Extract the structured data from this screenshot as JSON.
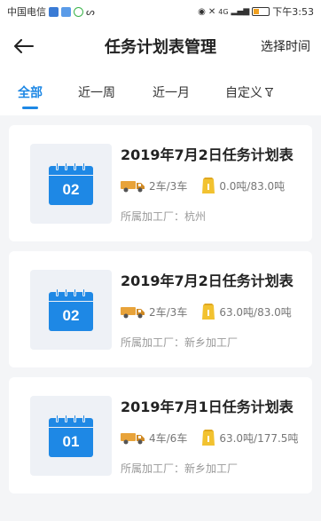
{
  "status_bar": {
    "carrier": "中国电信",
    "time": "下午3:53",
    "signal": "4G"
  },
  "header": {
    "title": "任务计划表管理",
    "action_label": "选择时间"
  },
  "tabs": [
    {
      "label": "全部",
      "active": true
    },
    {
      "label": "近一周",
      "active": false
    },
    {
      "label": "近一月",
      "active": false
    },
    {
      "label": "自定义",
      "active": false
    }
  ],
  "plans": [
    {
      "day": "02",
      "title": "2019年7月2日任务计划表",
      "trucks": "2车/3车",
      "weight": "0.0吨/83.0吨",
      "factory": "所属加工厂：杭州"
    },
    {
      "day": "02",
      "title": "2019年7月2日任务计划表",
      "trucks": "2车/3车",
      "weight": "63.0吨/83.0吨",
      "factory": "所属加工厂：新乡加工厂"
    },
    {
      "day": "01",
      "title": "2019年7月1日任务计划表",
      "trucks": "4车/6车",
      "weight": "63.0吨/177.5吨",
      "factory": "所属加工厂：新乡加工厂"
    }
  ],
  "colors": {
    "accent": "#1e88e5",
    "truck": "#e8a33a",
    "weight": "#f2c230"
  }
}
